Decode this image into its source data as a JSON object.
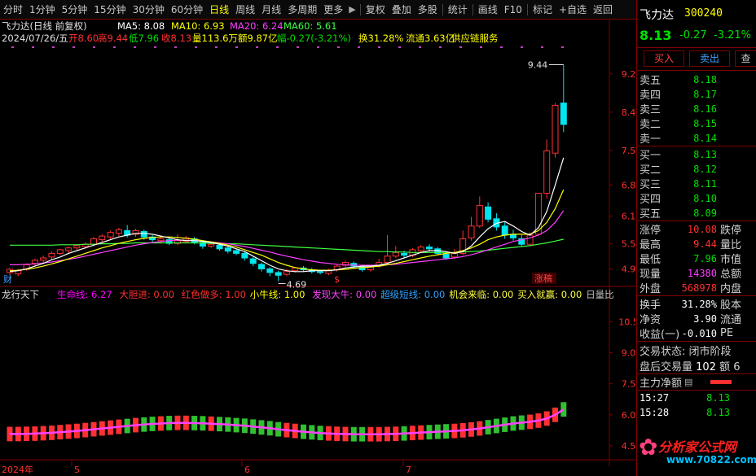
{
  "toolbar": {
    "items": [
      "分时",
      "1分钟",
      "5分钟",
      "15分钟",
      "30分钟",
      "60分钟",
      "日线",
      "周线",
      "月线",
      "多周期",
      "更多",
      "复权",
      "叠加",
      "多股",
      "统计",
      "画线",
      "F10",
      "标记",
      "+自选",
      "返回"
    ],
    "active_index": 6
  },
  "stock": {
    "name": "飞力达",
    "code": "300240",
    "price": "8.13",
    "change": "-0.27",
    "change_pct": "-3.21%"
  },
  "chart_header": {
    "title": "飞力达(日线 前复权)",
    "ma5": "MA5: 8.08",
    "ma10": "MA10: 6.93",
    "ma20": "MA20: 6.24",
    "ma60": "MA60: 5.61",
    "line2_date": "2024/07/26/五",
    "line2_open": "开8.60",
    "line2_high": "高9.44",
    "line2_low": "低7.96",
    "line2_close": "收8.13",
    "line2_vol": "量113.6万",
    "line2_amt": "额9.87亿",
    "line2_range": "幅-0.27(-3.21%)",
    "line2_turn": "换31.28%",
    "line2_float": "流通3.63亿",
    "line2_concept": "供应链服务"
  },
  "indicator_header": {
    "name": "龙行天下",
    "items": [
      {
        "label": "生命线: 6.27",
        "color": "#ff00ff"
      },
      {
        "label": "大胆进: 0.00",
        "color": "#ff3030"
      },
      {
        "label": "红色做多: 1.00",
        "color": "#ff3030"
      },
      {
        "label": "小牛线: 1.00",
        "color": "#ffff00"
      },
      {
        "label": "发现大牛: 0.00",
        "color": "#ff40ff"
      },
      {
        "label": "超级短线: 0.00",
        "color": "#30a0ff"
      },
      {
        "label": "机会来临: 0.00",
        "color": "#ffff40"
      },
      {
        "label": "买入就赢: 0.00",
        "color": "#ffff40"
      },
      {
        "label": "日量比",
        "color": "#c0c0c0"
      }
    ]
  },
  "chart_data": {
    "type": "candlestick",
    "price_ticks": [
      9.24,
      8.4,
      7.56,
      6.8,
      6.12,
      5.51,
      4.96
    ],
    "price_range": [
      4.7,
      9.7
    ],
    "indicator_ticks": [
      10.5,
      9.0,
      7.5,
      6.0,
      4.5
    ],
    "indicator_range": [
      4.3,
      11.5
    ],
    "annotations": {
      "high": "9.44",
      "low": "4.69",
      "cai": "财",
      "dollar": "$",
      "zhangting": "涨稿"
    },
    "x_labels": [
      "2024年",
      "5",
      "6",
      "7"
    ],
    "candles": [
      [
        4.88,
        4.95,
        4.82,
        4.98
      ],
      [
        4.85,
        4.92,
        4.8,
        4.96
      ],
      [
        4.95,
        5.05,
        4.92,
        5.08
      ],
      [
        5.08,
        5.15,
        5.02,
        5.18
      ],
      [
        5.15,
        5.2,
        5.1,
        5.25
      ],
      [
        5.22,
        5.3,
        5.18,
        5.34
      ],
      [
        5.3,
        5.38,
        5.26,
        5.4
      ],
      [
        5.36,
        5.42,
        5.3,
        5.45
      ],
      [
        5.42,
        5.47,
        5.38,
        5.5
      ],
      [
        5.45,
        5.5,
        5.4,
        5.54
      ],
      [
        5.5,
        5.62,
        5.46,
        5.66
      ],
      [
        5.6,
        5.68,
        5.55,
        5.72
      ],
      [
        5.66,
        5.76,
        5.62,
        5.8
      ],
      [
        5.74,
        5.82,
        5.68,
        5.86
      ],
      [
        5.8,
        5.7,
        5.65,
        5.92
      ],
      [
        5.72,
        5.8,
        5.66,
        5.84
      ],
      [
        5.78,
        5.66,
        5.6,
        5.82
      ],
      [
        5.66,
        5.6,
        5.55,
        5.7
      ],
      [
        5.58,
        5.62,
        5.52,
        5.66
      ],
      [
        5.6,
        5.52,
        5.48,
        5.64
      ],
      [
        5.52,
        5.58,
        5.48,
        5.72
      ],
      [
        5.56,
        5.64,
        5.52,
        5.68
      ],
      [
        5.62,
        5.55,
        5.5,
        5.66
      ],
      [
        5.54,
        5.46,
        5.4,
        5.58
      ],
      [
        5.46,
        5.5,
        5.42,
        5.54
      ],
      [
        5.48,
        5.4,
        5.36,
        5.52
      ],
      [
        5.42,
        5.35,
        5.3,
        5.46
      ],
      [
        5.36,
        5.3,
        5.26,
        5.4
      ],
      [
        5.3,
        5.2,
        5.14,
        5.34
      ],
      [
        5.18,
        5.08,
        5.02,
        5.22
      ],
      [
        5.06,
        4.96,
        4.9,
        5.1
      ],
      [
        4.96,
        4.88,
        4.8,
        5.0
      ],
      [
        4.88,
        4.82,
        4.69,
        4.92
      ],
      [
        4.84,
        4.9,
        4.8,
        4.96
      ],
      [
        4.92,
        4.98,
        4.88,
        5.0
      ],
      [
        4.98,
        4.94,
        4.9,
        5.02
      ],
      [
        4.94,
        4.9,
        4.86,
        4.98
      ],
      [
        4.9,
        4.88,
        4.84,
        4.94
      ],
      [
        4.86,
        4.92,
        4.82,
        4.96
      ],
      [
        4.94,
        5.02,
        4.9,
        5.06
      ],
      [
        5.04,
        5.1,
        5.0,
        5.14
      ],
      [
        5.08,
        5.02,
        4.96,
        5.12
      ],
      [
        5.0,
        4.94,
        4.9,
        5.04
      ],
      [
        4.94,
        5.0,
        4.9,
        5.04
      ],
      [
        5.02,
        5.1,
        4.98,
        5.18
      ],
      [
        5.1,
        5.24,
        5.06,
        5.7
      ],
      [
        5.24,
        5.32,
        5.2,
        5.46
      ],
      [
        5.3,
        5.26,
        5.2,
        5.36
      ],
      [
        5.26,
        5.38,
        5.22,
        5.42
      ],
      [
        5.36,
        5.44,
        5.32,
        5.48
      ],
      [
        5.44,
        5.4,
        5.34,
        5.5
      ],
      [
        5.4,
        5.3,
        5.26,
        5.44
      ],
      [
        5.28,
        5.2,
        5.16,
        5.32
      ],
      [
        5.22,
        5.3,
        5.18,
        5.4
      ],
      [
        5.3,
        5.62,
        5.26,
        5.8
      ],
      [
        5.64,
        5.9,
        5.58,
        6.1
      ],
      [
        5.9,
        6.35,
        5.86,
        6.55
      ],
      [
        6.32,
        6.05,
        5.98,
        6.42
      ],
      [
        6.06,
        5.88,
        5.8,
        6.18
      ],
      [
        5.9,
        5.7,
        5.62,
        6.0
      ],
      [
        5.72,
        5.64,
        5.58,
        5.82
      ],
      [
        5.62,
        5.5,
        5.46,
        5.7
      ],
      [
        5.5,
        5.7,
        5.46,
        5.76
      ],
      [
        5.72,
        6.62,
        5.7,
        6.62
      ],
      [
        6.62,
        7.55,
        6.5,
        7.8
      ],
      [
        7.5,
        8.55,
        7.4,
        8.6
      ],
      [
        8.6,
        8.13,
        7.96,
        9.44
      ]
    ],
    "ma5": [
      4.9,
      4.92,
      4.96,
      5.02,
      5.08,
      5.16,
      5.22,
      5.3,
      5.36,
      5.42,
      5.48,
      5.54,
      5.6,
      5.66,
      5.7,
      5.74,
      5.74,
      5.72,
      5.68,
      5.64,
      5.6,
      5.58,
      5.58,
      5.56,
      5.54,
      5.5,
      5.46,
      5.4,
      5.34,
      5.24,
      5.14,
      5.04,
      4.96,
      4.92,
      4.9,
      4.9,
      4.92,
      4.92,
      4.92,
      4.94,
      4.98,
      5.0,
      5.02,
      5.02,
      5.04,
      5.08,
      5.14,
      5.2,
      5.26,
      5.32,
      5.36,
      5.36,
      5.34,
      5.3,
      5.34,
      5.46,
      5.66,
      5.84,
      5.96,
      6.0,
      5.9,
      5.78,
      5.7,
      5.86,
      6.22,
      6.8,
      7.4
    ],
    "ma10": [
      4.92,
      4.93,
      4.95,
      4.98,
      5.02,
      5.07,
      5.12,
      5.18,
      5.24,
      5.3,
      5.36,
      5.42,
      5.47,
      5.52,
      5.56,
      5.6,
      5.63,
      5.65,
      5.66,
      5.66,
      5.65,
      5.63,
      5.61,
      5.58,
      5.55,
      5.52,
      5.48,
      5.44,
      5.38,
      5.32,
      5.26,
      5.18,
      5.1,
      5.04,
      4.99,
      4.96,
      4.94,
      4.93,
      4.93,
      4.94,
      4.95,
      4.97,
      4.99,
      5.0,
      5.02,
      5.05,
      5.08,
      5.12,
      5.16,
      5.2,
      5.24,
      5.27,
      5.3,
      5.32,
      5.36,
      5.42,
      5.5,
      5.6,
      5.66,
      5.7,
      5.72,
      5.72,
      5.72,
      5.8,
      5.98,
      6.28,
      6.7
    ],
    "ma20": [
      5.05,
      5.05,
      5.06,
      5.07,
      5.09,
      5.11,
      5.14,
      5.17,
      5.2,
      5.24,
      5.28,
      5.32,
      5.36,
      5.4,
      5.44,
      5.48,
      5.51,
      5.54,
      5.56,
      5.58,
      5.59,
      5.59,
      5.58,
      5.57,
      5.55,
      5.53,
      5.51,
      5.48,
      5.45,
      5.41,
      5.37,
      5.33,
      5.28,
      5.24,
      5.2,
      5.16,
      5.13,
      5.1,
      5.08,
      5.06,
      5.05,
      5.04,
      5.04,
      5.04,
      5.04,
      5.05,
      5.06,
      5.08,
      5.1,
      5.12,
      5.14,
      5.16,
      5.18,
      5.2,
      5.23,
      5.27,
      5.32,
      5.38,
      5.44,
      5.5,
      5.56,
      5.6,
      5.64,
      5.7,
      5.8,
      5.98,
      6.24
    ],
    "ma60": [
      5.48,
      5.48,
      5.48,
      5.48,
      5.48,
      5.48,
      5.49,
      5.49,
      5.49,
      5.5,
      5.5,
      5.51,
      5.51,
      5.52,
      5.52,
      5.53,
      5.53,
      5.53,
      5.53,
      5.53,
      5.53,
      5.53,
      5.53,
      5.53,
      5.52,
      5.52,
      5.51,
      5.51,
      5.5,
      5.49,
      5.48,
      5.47,
      5.46,
      5.45,
      5.44,
      5.43,
      5.42,
      5.41,
      5.4,
      5.39,
      5.38,
      5.37,
      5.36,
      5.35,
      5.34,
      5.34,
      5.33,
      5.33,
      5.32,
      5.32,
      5.32,
      5.32,
      5.32,
      5.32,
      5.33,
      5.34,
      5.35,
      5.37,
      5.39,
      5.41,
      5.43,
      5.45,
      5.47,
      5.5,
      5.53,
      5.57,
      5.61
    ]
  },
  "side": {
    "buttons": [
      "买入",
      "卖出",
      "查"
    ],
    "sell": [
      {
        "label": "卖五",
        "price": "8.18",
        "vol": ""
      },
      {
        "label": "卖四",
        "price": "8.17",
        "vol": ""
      },
      {
        "label": "卖三",
        "price": "8.16",
        "vol": ""
      },
      {
        "label": "卖二",
        "price": "8.15",
        "vol": ""
      },
      {
        "label": "卖一",
        "price": "8.14",
        "vol": ""
      }
    ],
    "buy": [
      {
        "label": "买一",
        "price": "8.13",
        "vol": ""
      },
      {
        "label": "买二",
        "price": "8.12",
        "vol": ""
      },
      {
        "label": "买三",
        "price": "8.11",
        "vol": ""
      },
      {
        "label": "买四",
        "price": "8.10",
        "vol": ""
      },
      {
        "label": "买五",
        "price": "8.09",
        "vol": ""
      }
    ],
    "stats": [
      {
        "label": "涨停",
        "value": "10.08",
        "color": "#ff3030",
        "extra": "跌停"
      },
      {
        "label": "最高",
        "value": "9.44",
        "color": "#ff3030",
        "extra": "量比"
      },
      {
        "label": "最低",
        "value": "7.96",
        "color": "#00e000",
        "extra": "市值"
      },
      {
        "label": "现量",
        "value": "14380",
        "color": "#ff40ff",
        "extra": "总额"
      },
      {
        "label": "外盘",
        "value": "568978",
        "color": "#ff3030",
        "extra": "内盘"
      }
    ],
    "stats2": [
      {
        "label": "换手",
        "value": "31.28%",
        "extra": "股本"
      },
      {
        "label": "净资",
        "value": "3.90",
        "extra": "流通"
      },
      {
        "label": "收益(一)",
        "value": "-0.010",
        "extra": "PE"
      }
    ],
    "trade_status": "交易状态: 闭市阶段",
    "after_hours": "盘后交易量",
    "after_hours_vol": "102",
    "after_hours_amt": "额 6",
    "main_net": "主力净额",
    "ticks": [
      {
        "time": "15:27",
        "price": "8.13"
      },
      {
        "time": "15:28",
        "price": "8.13"
      }
    ],
    "logo": "分析家公式网",
    "logo_url": "www.70822.com"
  }
}
